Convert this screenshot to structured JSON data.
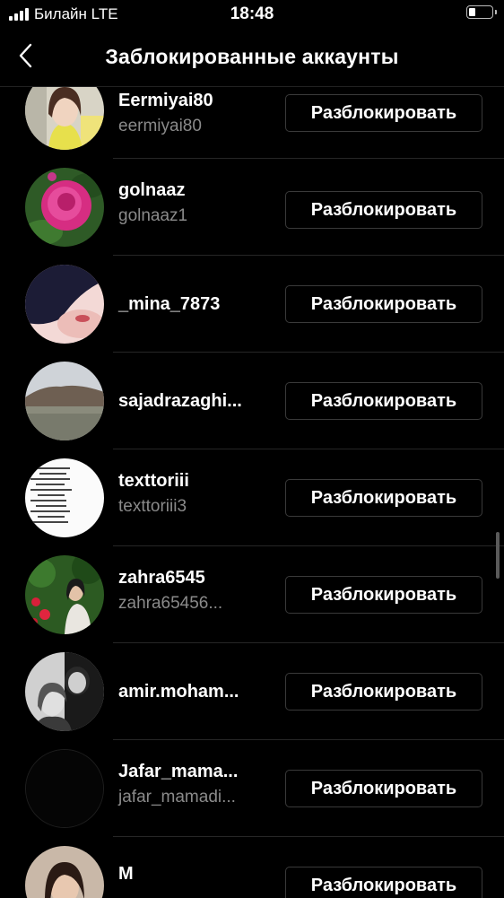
{
  "status_bar": {
    "carrier": "Билайн  LTE",
    "time": "18:48"
  },
  "header": {
    "title": "Заблокированные аккаунты"
  },
  "blocked_accounts": [
    {
      "name": "Eermiyai80",
      "handle": "eermiyai80",
      "button": "Разблокировать"
    },
    {
      "name": "golnaaz",
      "handle": "golnaaz1",
      "button": "Разблокировать"
    },
    {
      "name": "_mina_7873",
      "handle": "",
      "button": "Разблокировать"
    },
    {
      "name": "sajadrazaghi...",
      "handle": "",
      "button": "Разблокировать"
    },
    {
      "name": "texttoriii",
      "handle": "texttoriii3",
      "button": "Разблокировать"
    },
    {
      "name": "zahra6545",
      "handle": "zahra65456...",
      "button": "Разблокировать"
    },
    {
      "name": "amir.moham...",
      "handle": "",
      "button": "Разблокировать"
    },
    {
      "name": "Jafar_mama...",
      "handle": "jafar_mamadi...",
      "button": "Разблокировать"
    },
    {
      "name": "M",
      "handle": "",
      "button": "Разблокировать"
    }
  ]
}
